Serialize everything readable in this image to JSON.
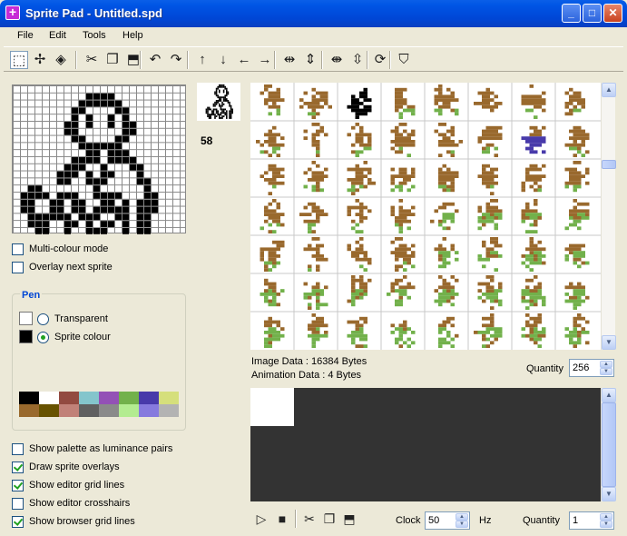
{
  "window": {
    "title": "Sprite Pad - Untitled.spd",
    "app_icon": "plus-app-icon",
    "buttons": {
      "minimize": "_",
      "maximize": "□",
      "close": "✕"
    }
  },
  "menu": [
    "File",
    "Edit",
    "Tools",
    "Help"
  ],
  "toolbar": [
    {
      "name": "select-tool",
      "glyph": "⬚",
      "active": true
    },
    {
      "name": "pencil-tool",
      "glyph": "✢"
    },
    {
      "name": "fill-tool",
      "glyph": "◈"
    },
    {
      "name": "cut-tool",
      "glyph": "✂"
    },
    {
      "name": "copy-tool",
      "glyph": "❐"
    },
    {
      "name": "paste-tool",
      "glyph": "⬒"
    },
    {
      "name": "undo-tool",
      "glyph": "↶"
    },
    {
      "name": "redo-tool",
      "glyph": "↷"
    },
    {
      "name": "shift-up-tool",
      "glyph": "↑"
    },
    {
      "name": "shift-down-tool",
      "glyph": "↓"
    },
    {
      "name": "shift-left-tool",
      "glyph": "←"
    },
    {
      "name": "shift-right-tool",
      "glyph": "→"
    },
    {
      "name": "flip-horizontal-tool",
      "glyph": "⇹"
    },
    {
      "name": "flip-vertical-tool",
      "glyph": "⇕"
    },
    {
      "name": "stretch-horizontal-tool",
      "glyph": "⇼"
    },
    {
      "name": "stretch-vertical-tool",
      "glyph": "⇳"
    },
    {
      "name": "rotate-tool",
      "glyph": "⟳"
    },
    {
      "name": "test-tool",
      "glyph": "⛉"
    }
  ],
  "editor": {
    "sprite_number": "58"
  },
  "options": {
    "multicolour": {
      "label": "Multi-colour mode",
      "checked": false
    },
    "overlay_next": {
      "label": "Overlay next sprite",
      "checked": false
    }
  },
  "pen": {
    "title": "Pen",
    "transparent_label": "Transparent",
    "sprite_colour_label": "Sprite colour",
    "selected": "sprite_colour",
    "palette": [
      "#000000",
      "#FFFFFF",
      "#924A40",
      "#84C5CC",
      "#9351B6",
      "#72B14B",
      "#483AAA",
      "#D5DF7C",
      "#99692D",
      "#675200",
      "#C18178",
      "#606060",
      "#8A8A8A",
      "#B3EC91",
      "#867ADE",
      "#B3B3B3"
    ]
  },
  "bottom_options": [
    {
      "key": "lum_pairs",
      "label": "Show palette as luminance pairs",
      "checked": false
    },
    {
      "key": "draw_overlays",
      "label": "Draw sprite overlays",
      "checked": true
    },
    {
      "key": "editor_grid",
      "label": "Show editor grid lines",
      "checked": true
    },
    {
      "key": "editor_crosshairs",
      "label": "Show editor crosshairs",
      "checked": false
    },
    {
      "key": "browser_grid",
      "label": "Show browser grid lines",
      "checked": true
    }
  ],
  "info": {
    "image_data": "Image Data : 16384 Bytes",
    "animation_data": "Animation Data : 4 Bytes",
    "quantity_label": "Quantity",
    "quantity_value": "256"
  },
  "animation": {
    "clock_label": "Clock",
    "clock_value": "50",
    "hz_label": "Hz",
    "quantity_label": "Quantity",
    "quantity_value": "1"
  },
  "colors": {
    "sprite_brown": "#99692D",
    "sprite_green": "#72B14B",
    "sprite_blue": "#483AAA",
    "anim_bg": "#333333"
  }
}
